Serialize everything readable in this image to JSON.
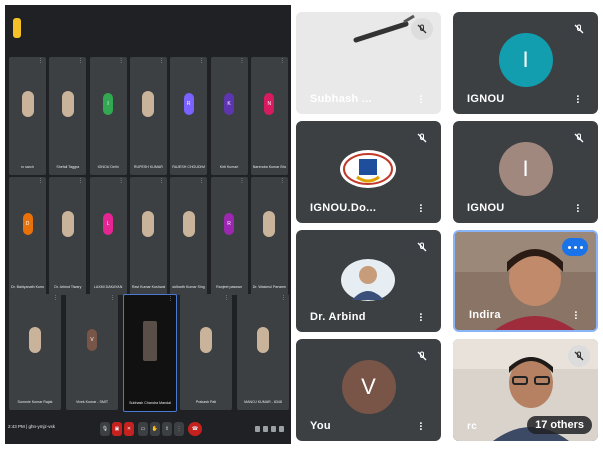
{
  "screen_share": {
    "row1": [
      {
        "name": "rc sarch",
        "kind": "photo"
      },
      {
        "name": "Shefali Taggra",
        "kind": "photo"
      },
      {
        "name": "IGNOU Delhi",
        "kind": "letter",
        "letter": "I",
        "color": "#33a852"
      },
      {
        "name": "RUPESH KUMAR",
        "kind": "photo"
      },
      {
        "name": "RAJESH CHOUDHARY",
        "kind": "letter",
        "letter": "R",
        "color": "#7b61ff"
      },
      {
        "name": "Kirti Kumari",
        "kind": "letter",
        "letter": "K",
        "color": "#5e35b1"
      },
      {
        "name": "Narendra Kumar Bhatia",
        "kind": "letter",
        "letter": "N",
        "color": "#d81b60"
      }
    ],
    "row2": [
      {
        "name": "Dr. Baidyanath Kumar",
        "kind": "letter",
        "letter": "D",
        "color": "#e8710a"
      },
      {
        "name": "Dr. Arbind Tiwary",
        "kind": "photo"
      },
      {
        "name": "LAXMI DAKAYAN",
        "kind": "letter",
        "letter": "L",
        "color": "#e52592"
      },
      {
        "name": "Ravi Kumar Kushwaha",
        "kind": "photo"
      },
      {
        "name": "sidharth Kumar Singh",
        "kind": "photo"
      },
      {
        "name": "Ranjeet paswan",
        "kind": "letter",
        "letter": "R",
        "color": "#9c27b0"
      },
      {
        "name": "Dr. Wasimul Parween",
        "kind": "photo"
      }
    ],
    "row3": [
      {
        "name": "Sunnnie Kumar Rajak",
        "kind": "photo"
      },
      {
        "name": "Vivek Kumar - SMIT",
        "kind": "letter",
        "letter": "V",
        "color": "#795548"
      },
      {
        "name": "Subhash Chandra Mandal",
        "kind": "dark"
      },
      {
        "name": "Prakash Pati",
        "kind": "photo"
      },
      {
        "name": "MANOJ KUMAR - 8348",
        "kind": "photo"
      }
    ],
    "time": "2:43 PM",
    "meeting_code": "ghn-ymjz-vsk"
  },
  "tiles": [
    {
      "label": "Subhash ...",
      "type": "video"
    },
    {
      "label": "IGNOU",
      "type": "letter",
      "letter": "I",
      "color": "#129eaf"
    },
    {
      "label": "IGNOU.Do...",
      "type": "logo"
    },
    {
      "label": "IGNOU",
      "type": "letter",
      "letter": "I",
      "color": "#a1887f"
    },
    {
      "label": "Dr. Arbind",
      "type": "avatar-photo"
    },
    {
      "label": "Indira",
      "type": "video-speaking"
    },
    {
      "label": "You",
      "type": "letter",
      "letter": "V",
      "color": "#795548"
    },
    {
      "label": "rc",
      "type": "video",
      "others": "17 others"
    }
  ]
}
